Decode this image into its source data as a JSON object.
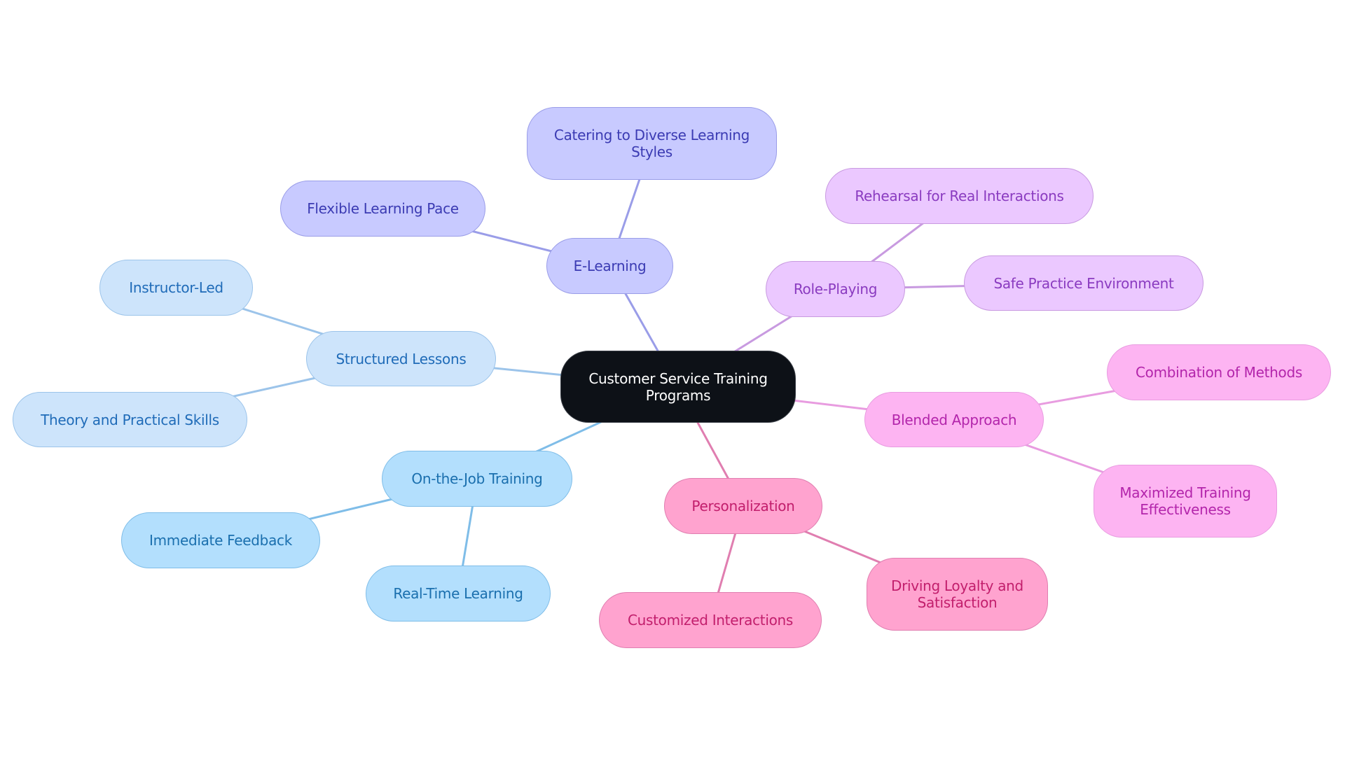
{
  "root": {
    "id": "root",
    "label": "Customer Service Training Programs"
  },
  "branches": [
    {
      "id": "elearning",
      "label": "E-Learning",
      "group": "g-elearn",
      "edge_color": "#9a9de8",
      "children": [
        {
          "id": "catering",
          "label": "Catering to Diverse Learning Styles"
        },
        {
          "id": "flexible",
          "label": "Flexible Learning Pace"
        }
      ]
    },
    {
      "id": "roleplaying",
      "label": "Role-Playing",
      "group": "g-role",
      "edge_color": "#c89ae0",
      "children": [
        {
          "id": "rehearsal",
          "label": "Rehearsal for Real Interactions"
        },
        {
          "id": "safe",
          "label": "Safe Practice Environment"
        }
      ]
    },
    {
      "id": "blended",
      "label": "Blended Approach",
      "group": "g-blend",
      "edge_color": "#e89ce0",
      "children": [
        {
          "id": "combination",
          "label": "Combination of Methods"
        },
        {
          "id": "maximized",
          "label": "Maximized Training Effectiveness"
        }
      ]
    },
    {
      "id": "personalization",
      "label": "Personalization",
      "group": "g-pers",
      "edge_color": "#e07eb0",
      "children": [
        {
          "id": "driving",
          "label": "Driving Loyalty and Satisfaction"
        },
        {
          "id": "customized",
          "label": "Customized Interactions"
        }
      ]
    },
    {
      "id": "ojt",
      "label": "On-the-Job Training",
      "group": "g-ojt",
      "edge_color": "#7fbde8",
      "children": [
        {
          "id": "immediate",
          "label": "Immediate Feedback"
        },
        {
          "id": "realtime",
          "label": "Real-Time Learning"
        }
      ]
    },
    {
      "id": "structured",
      "label": "Structured Lessons",
      "group": "g-struct",
      "edge_color": "#9cc4ea",
      "children": [
        {
          "id": "instructor",
          "label": "Instructor-Led"
        },
        {
          "id": "theory",
          "label": "Theory and Practical Skills"
        }
      ]
    }
  ]
}
